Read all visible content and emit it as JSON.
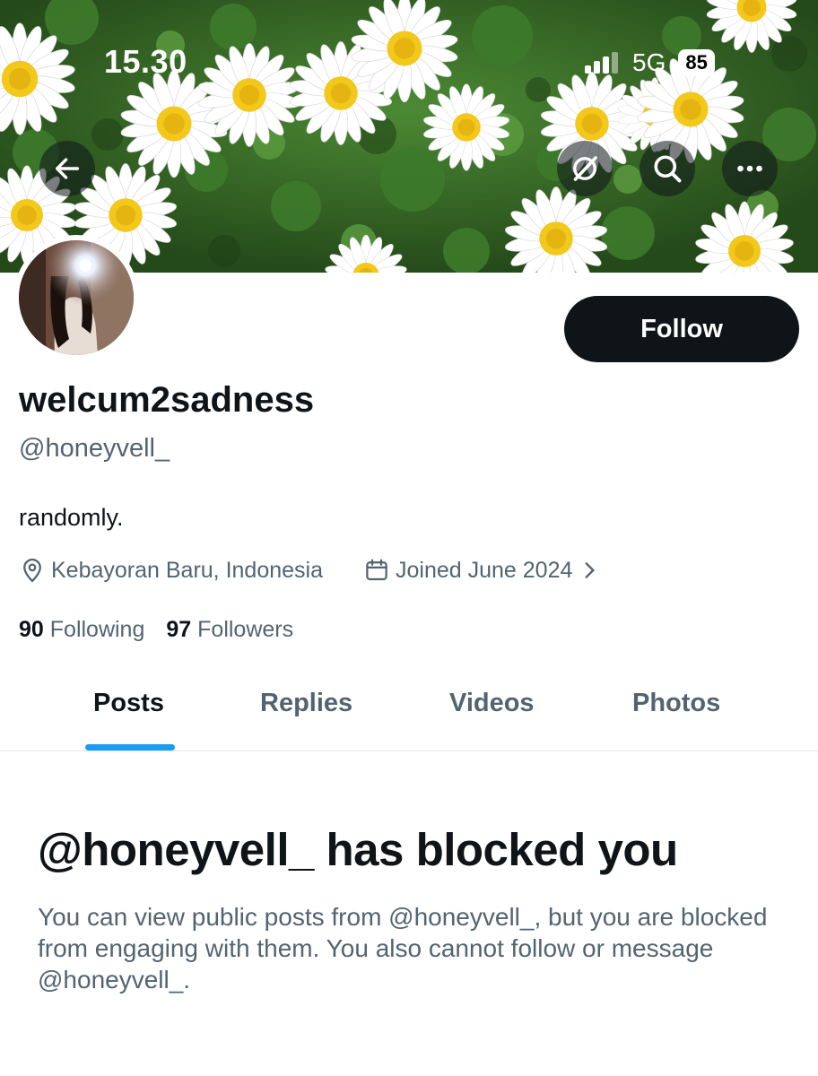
{
  "status_bar": {
    "time": "15.30",
    "network": "5G",
    "battery": "85"
  },
  "header": {
    "back_icon": "arrow-left-icon",
    "grok_icon": "grok-icon",
    "search_icon": "search-icon",
    "more_icon": "more-horizontal-icon"
  },
  "profile": {
    "display_name": "welcum2sadness",
    "handle": "@honeyvell_",
    "bio": "randomly.",
    "location": "Kebayoran Baru, Indonesia",
    "joined": "Joined June 2024",
    "following_count": "90",
    "following_label": "Following",
    "followers_count": "97",
    "followers_label": "Followers",
    "follow_button": "Follow"
  },
  "tabs": [
    {
      "label": "Posts",
      "active": true
    },
    {
      "label": "Replies",
      "active": false
    },
    {
      "label": "Videos",
      "active": false
    },
    {
      "label": "Photos",
      "active": false
    }
  ],
  "blocked": {
    "title": "@honeyvell_ has blocked you",
    "description": "You can view public posts from @honeyvell_, but you are blocked from engaging with them. You also cannot follow or message @honeyvell_."
  },
  "colors": {
    "accent": "#1d9bf0",
    "text_primary": "#0f1419",
    "text_secondary": "#536471",
    "follow_button_bg": "#0f1419"
  }
}
